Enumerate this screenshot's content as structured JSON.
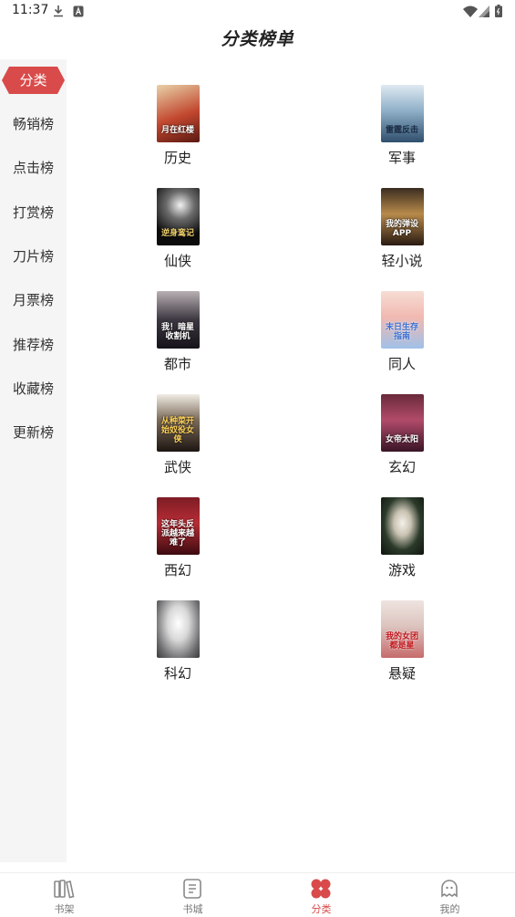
{
  "status_bar": {
    "time": "11:37",
    "icons": [
      "download-icon",
      "a-icon",
      "wifi-icon",
      "signal-icon",
      "battery-icon"
    ]
  },
  "header": {
    "title": "分类榜单"
  },
  "sidebar": {
    "items": [
      {
        "label": "分类",
        "active": true
      },
      {
        "label": "畅销榜"
      },
      {
        "label": "点击榜"
      },
      {
        "label": "打赏榜"
      },
      {
        "label": "刀片榜"
      },
      {
        "label": "月票榜"
      },
      {
        "label": "推荐榜"
      },
      {
        "label": "收藏榜"
      },
      {
        "label": "更新榜"
      }
    ]
  },
  "categories": [
    {
      "label": "历史",
      "cover_text": "月在红楼"
    },
    {
      "label": "军事",
      "cover_text": "雷霆反击"
    },
    {
      "label": "仙侠",
      "cover_text": "逆身鸾记"
    },
    {
      "label": "轻小说",
      "cover_text": "我的弹设APP"
    },
    {
      "label": "都市",
      "cover_text": "我！暗星收割机"
    },
    {
      "label": "同人",
      "cover_text": "末日生存指南"
    },
    {
      "label": "武侠",
      "cover_text": "从种菜开始奴役女侠"
    },
    {
      "label": "玄幻",
      "cover_text": "女帝太阳"
    },
    {
      "label": "西幻",
      "cover_text": "这年头反派越来越难了"
    },
    {
      "label": "游戏",
      "cover_text": ""
    },
    {
      "label": "科幻",
      "cover_text": ""
    },
    {
      "label": "悬疑",
      "cover_text": "我的女团都是星"
    }
  ],
  "bottom_nav": {
    "items": [
      {
        "label": "书架",
        "icon": "bookshelf-icon"
      },
      {
        "label": "书城",
        "icon": "bookstore-icon"
      },
      {
        "label": "分类",
        "icon": "category-icon",
        "active": true
      },
      {
        "label": "我的",
        "icon": "profile-icon"
      }
    ]
  },
  "colors": {
    "accent": "#d94a4a",
    "sidebar_bg": "#f5f5f5"
  }
}
